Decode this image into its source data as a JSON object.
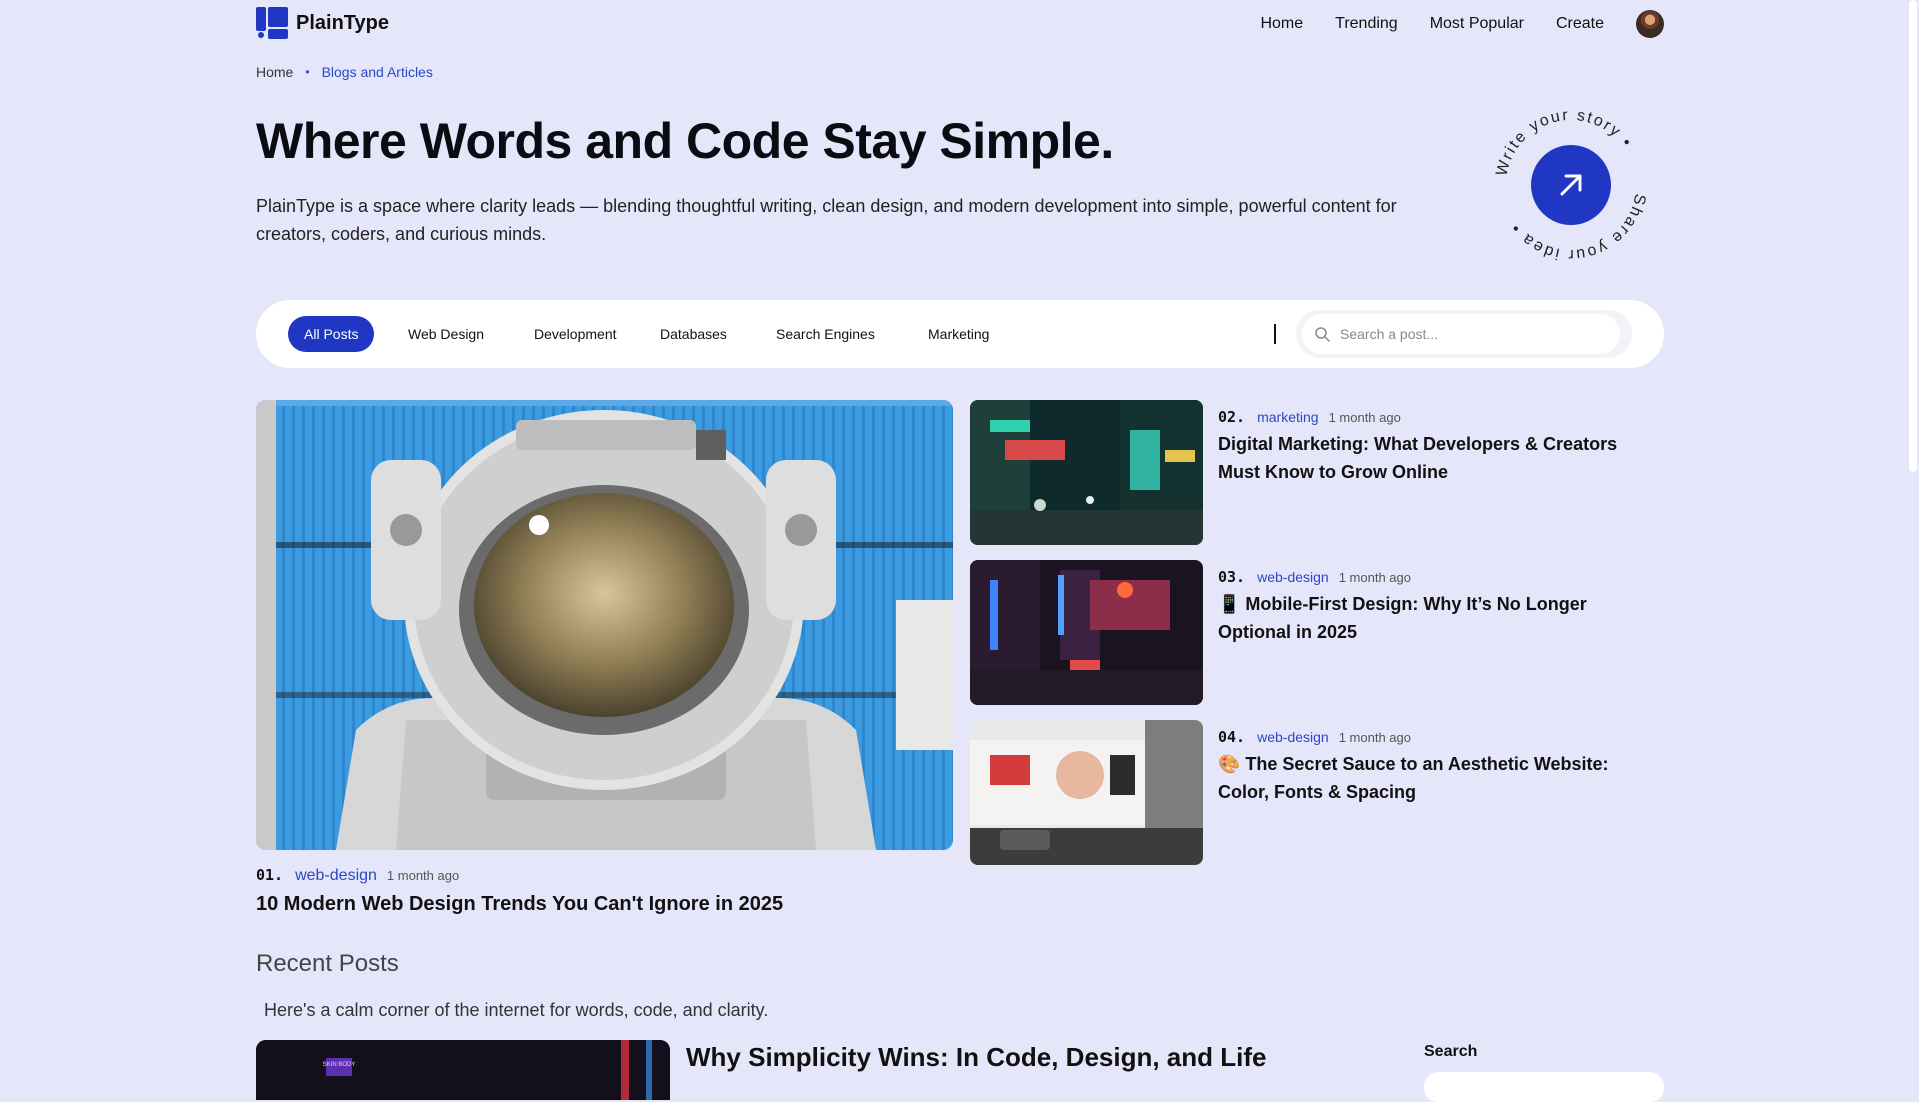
{
  "brand": {
    "name": "PlainType",
    "accent": "#1f37c2"
  },
  "nav": {
    "items": [
      "Home",
      "Trending",
      "Most Popular",
      "Create"
    ]
  },
  "breadcrumb": {
    "home": "Home",
    "separator": "•",
    "current": "Blogs and Articles"
  },
  "hero": {
    "title": "Where Words and Code Stay Simple.",
    "description": "PlainType is a space where clarity leads — blending thoughtful writing, clean design, and modern development into simple, powerful content for creators, coders, and curious minds.",
    "badge_text_top": "Write your story •",
    "badge_text_bottom": "Share your idea •"
  },
  "filters": {
    "chips": [
      "All Posts",
      "Web Design",
      "Development",
      "Databases",
      "Search Engines",
      "Marketing"
    ],
    "active": "All Posts",
    "search_placeholder": "Search a post..."
  },
  "featured": {
    "number": "01.",
    "category": "web-design",
    "time": "1 month ago",
    "title": "10 Modern Web Design Trends You Can't Ignore in 2025"
  },
  "side_posts": [
    {
      "number": "02.",
      "category": "marketing",
      "time": "1 month ago",
      "title": "Digital Marketing: What Developers & Creators Must Know to Grow Online"
    },
    {
      "number": "03.",
      "category": "web-design",
      "time": "1 month ago",
      "title": "📱 Mobile-First Design: Why It’s No Longer Optional in 2025"
    },
    {
      "number": "04.",
      "category": "web-design",
      "time": "1 month ago",
      "title": "🎨 The Secret Sauce to an Aesthetic Website: Color, Fonts & Spacing"
    }
  ],
  "recent": {
    "heading": "Recent Posts",
    "subtitle": "Here's a calm corner of the internet for words, code, and clarity.",
    "first_title": "Why Simplicity Wins: In Code, Design, and Life",
    "image_sign": "SKIN BODY"
  },
  "sidebar": {
    "search_label": "Search"
  }
}
